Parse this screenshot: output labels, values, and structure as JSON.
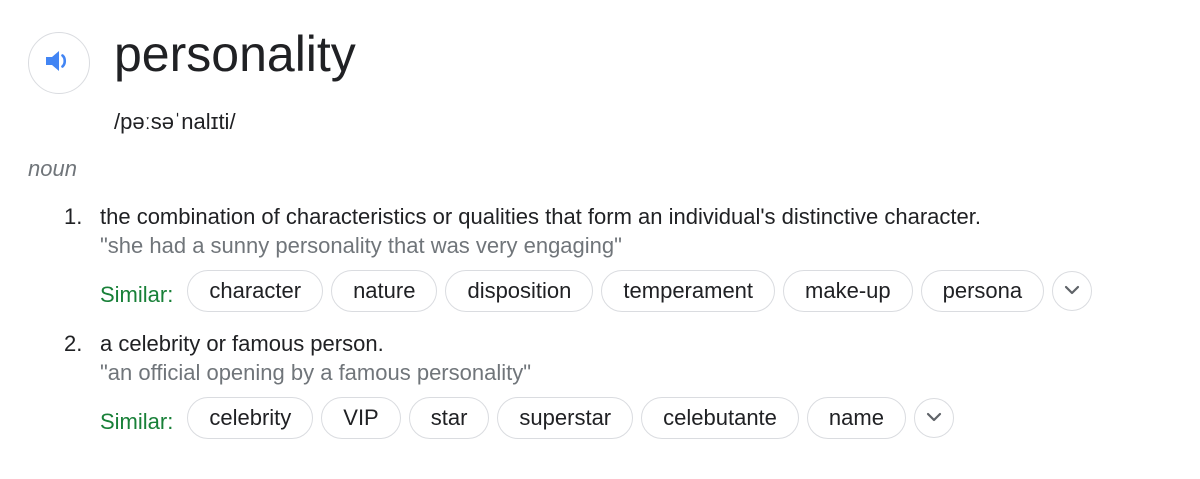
{
  "entry": {
    "word": "personality",
    "phonetic": "/pəːsəˈnalɪti/",
    "part_of_speech": "noun",
    "speaker_icon": "volume-up-icon",
    "accent_color": "#4285f4"
  },
  "senses": [
    {
      "number": "1.",
      "definition": "the combination of characteristics or qualities that form an individual's distinctive character.",
      "example": "\"she had a sunny personality that was very engaging\"",
      "similar_label": "Similar:",
      "similar": [
        "character",
        "nature",
        "disposition",
        "temperament",
        "make-up",
        "persona"
      ],
      "more_icon": "chevron-down-icon"
    },
    {
      "number": "2.",
      "definition": "a celebrity or famous person.",
      "example": "\"an official opening by a famous personality\"",
      "similar_label": "Similar:",
      "similar": [
        "celebrity",
        "VIP",
        "star",
        "superstar",
        "celebutante",
        "name"
      ],
      "more_icon": "chevron-down-icon"
    }
  ],
  "colors": {
    "similar_label": "#188038",
    "muted_text": "#70757a",
    "chip_border": "#dadce0"
  }
}
